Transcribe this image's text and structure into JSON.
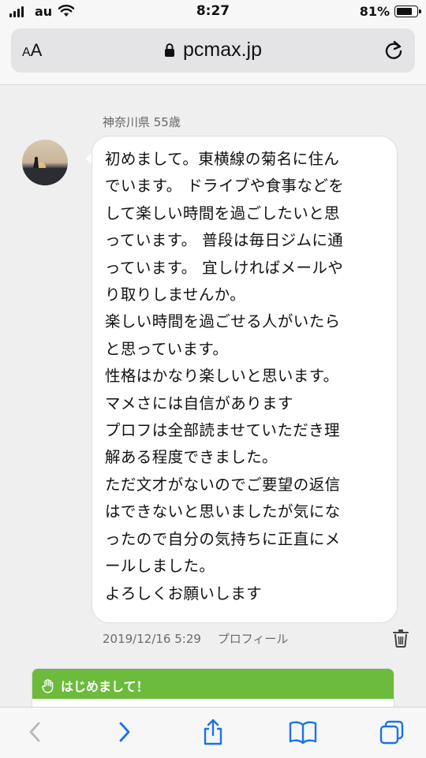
{
  "status_bar": {
    "carrier": "au",
    "time": "8:27",
    "battery_percent": "81%",
    "battery_level": 0.81
  },
  "browser": {
    "text_size_label_small": "A",
    "text_size_label_large": "A",
    "url": "pcmax.jp"
  },
  "message": {
    "sender_info": "神奈川県 55歳",
    "lines": [
      "初めまして。東横線の菊名に住ん",
      "でいます。 ドライブや食事などを",
      "して楽しい時間を過ごしたいと思",
      "っています。 普段は毎日ジムに通",
      "っています。 宜しければメールや",
      "り取りしませんか。",
      "楽しい時間を過ごせる人がいたら",
      "と思っています。",
      "性格はかなり楽しいと思います。",
      "マメさには自信があります",
      "プロフは全部読ませていただき理",
      "解ある程度できました。",
      "ただ文才がないのでご要望の返信",
      "はできないと思いましたが気にな",
      "ったので自分の気持ちに正直にメ",
      "ールしました。",
      "よろしくお願いします"
    ],
    "timestamp": "2019/12/16 5:29",
    "profile_link": "プロフィール"
  },
  "card": {
    "header": "はじめまして！",
    "header_color": "#6cbb3c"
  },
  "toolbar": {
    "icons": [
      "back-icon",
      "forward-icon",
      "share-icon",
      "bookmarks-icon",
      "tabs-icon"
    ],
    "accent_color": "#1a73e8"
  }
}
